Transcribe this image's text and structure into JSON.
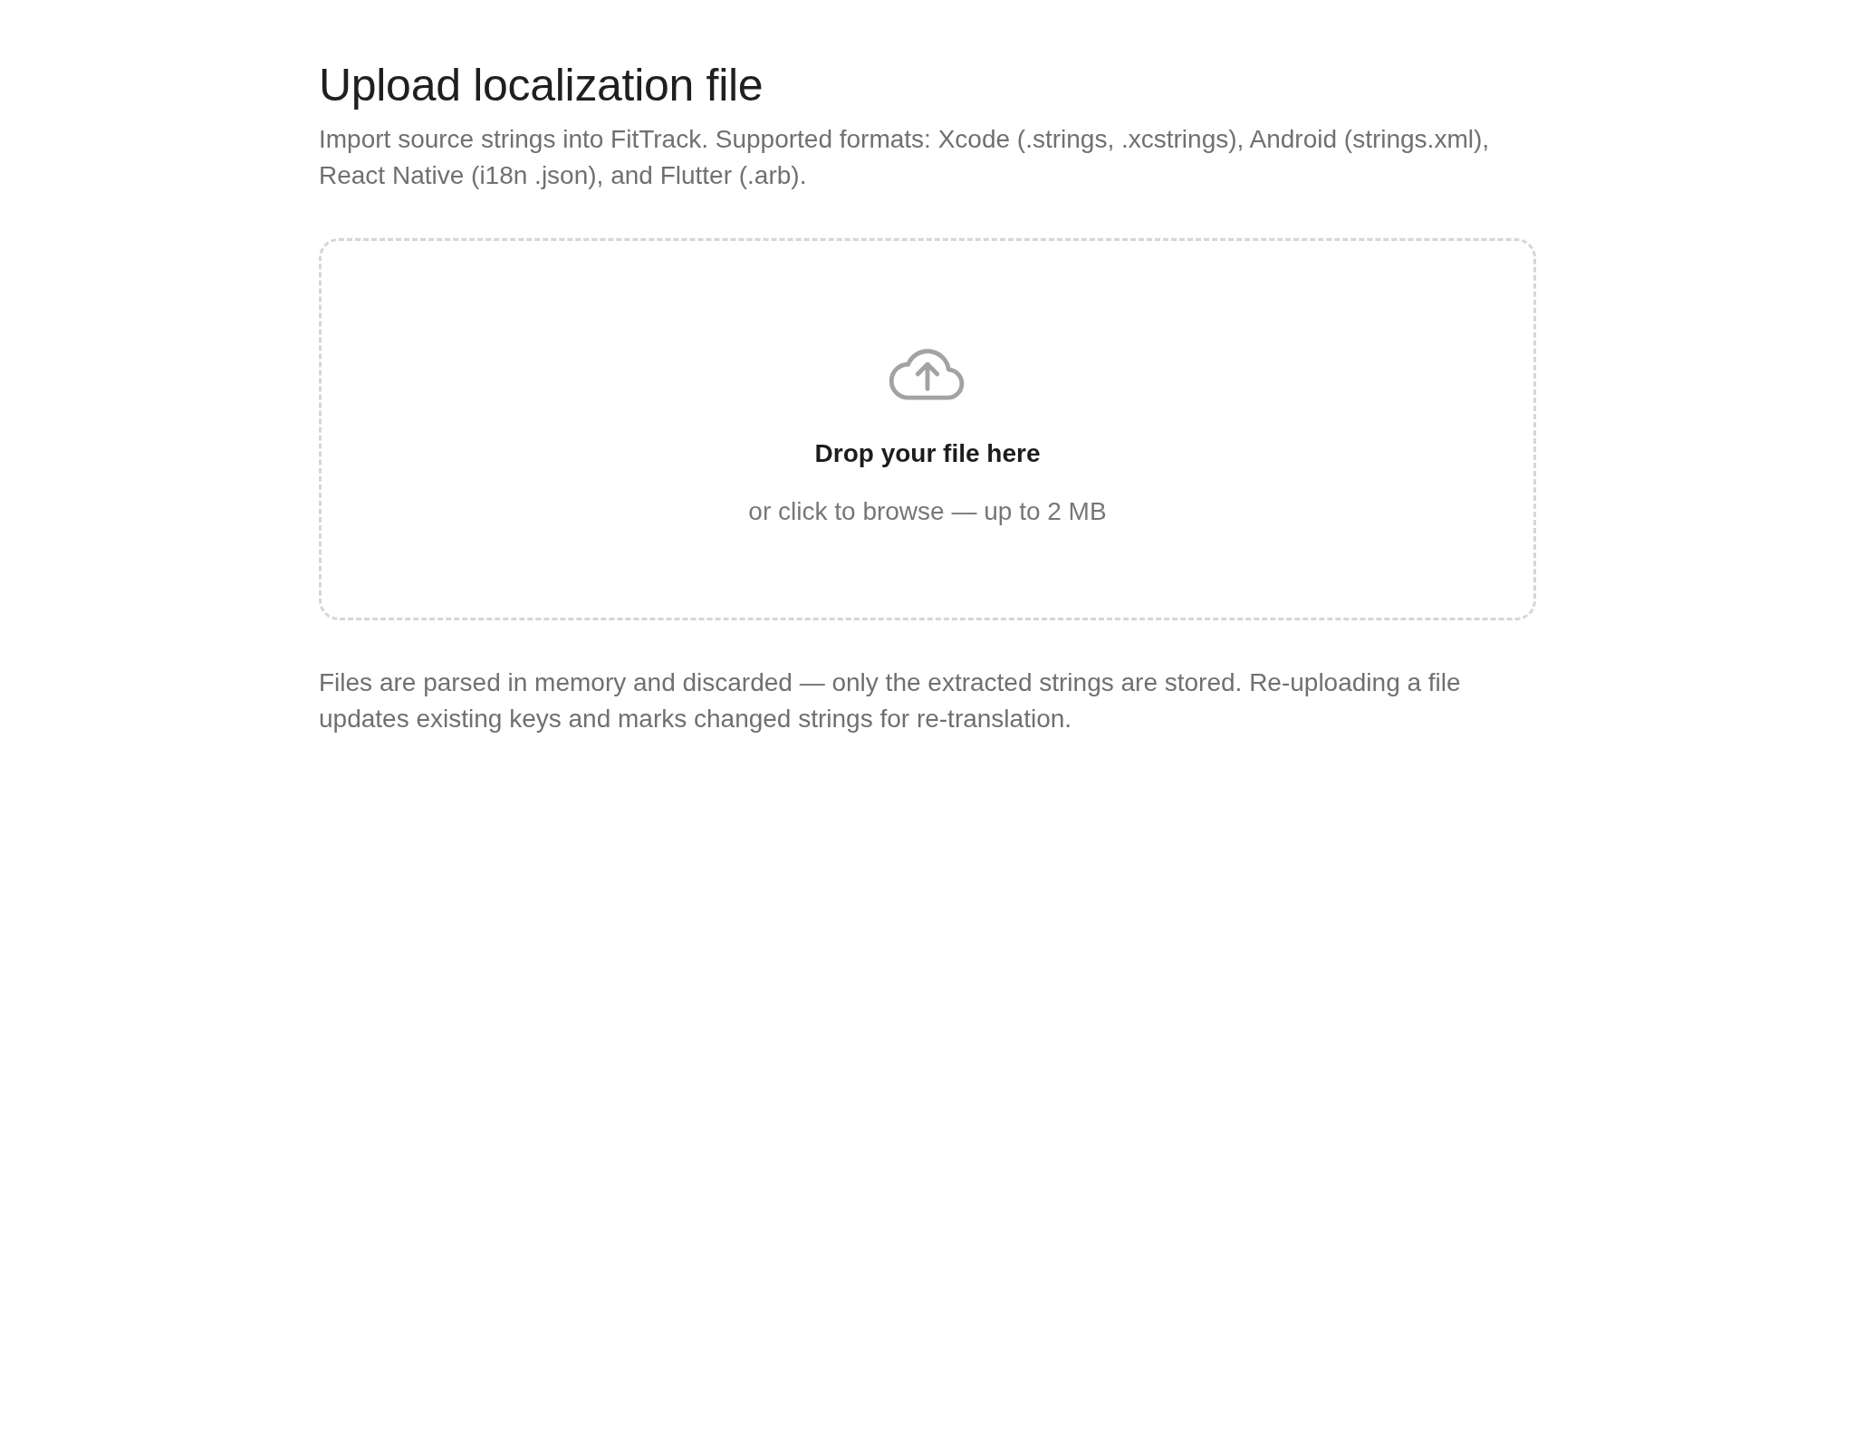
{
  "header": {
    "title": "Upload localization file",
    "description": "Import source strings into FitTrack. Supported formats: Xcode (.strings, .xcstrings), Android (strings.xml), React Native (i18n .json), and Flutter (.arb)."
  },
  "dropzone": {
    "heading": "Drop your file here",
    "hint": "or click to browse — up to 2 MB"
  },
  "note": "Files are parsed in memory and discarded — only the extracted strings are stored. Re-uploading a file updates existing keys and marks changed strings for re-translation."
}
